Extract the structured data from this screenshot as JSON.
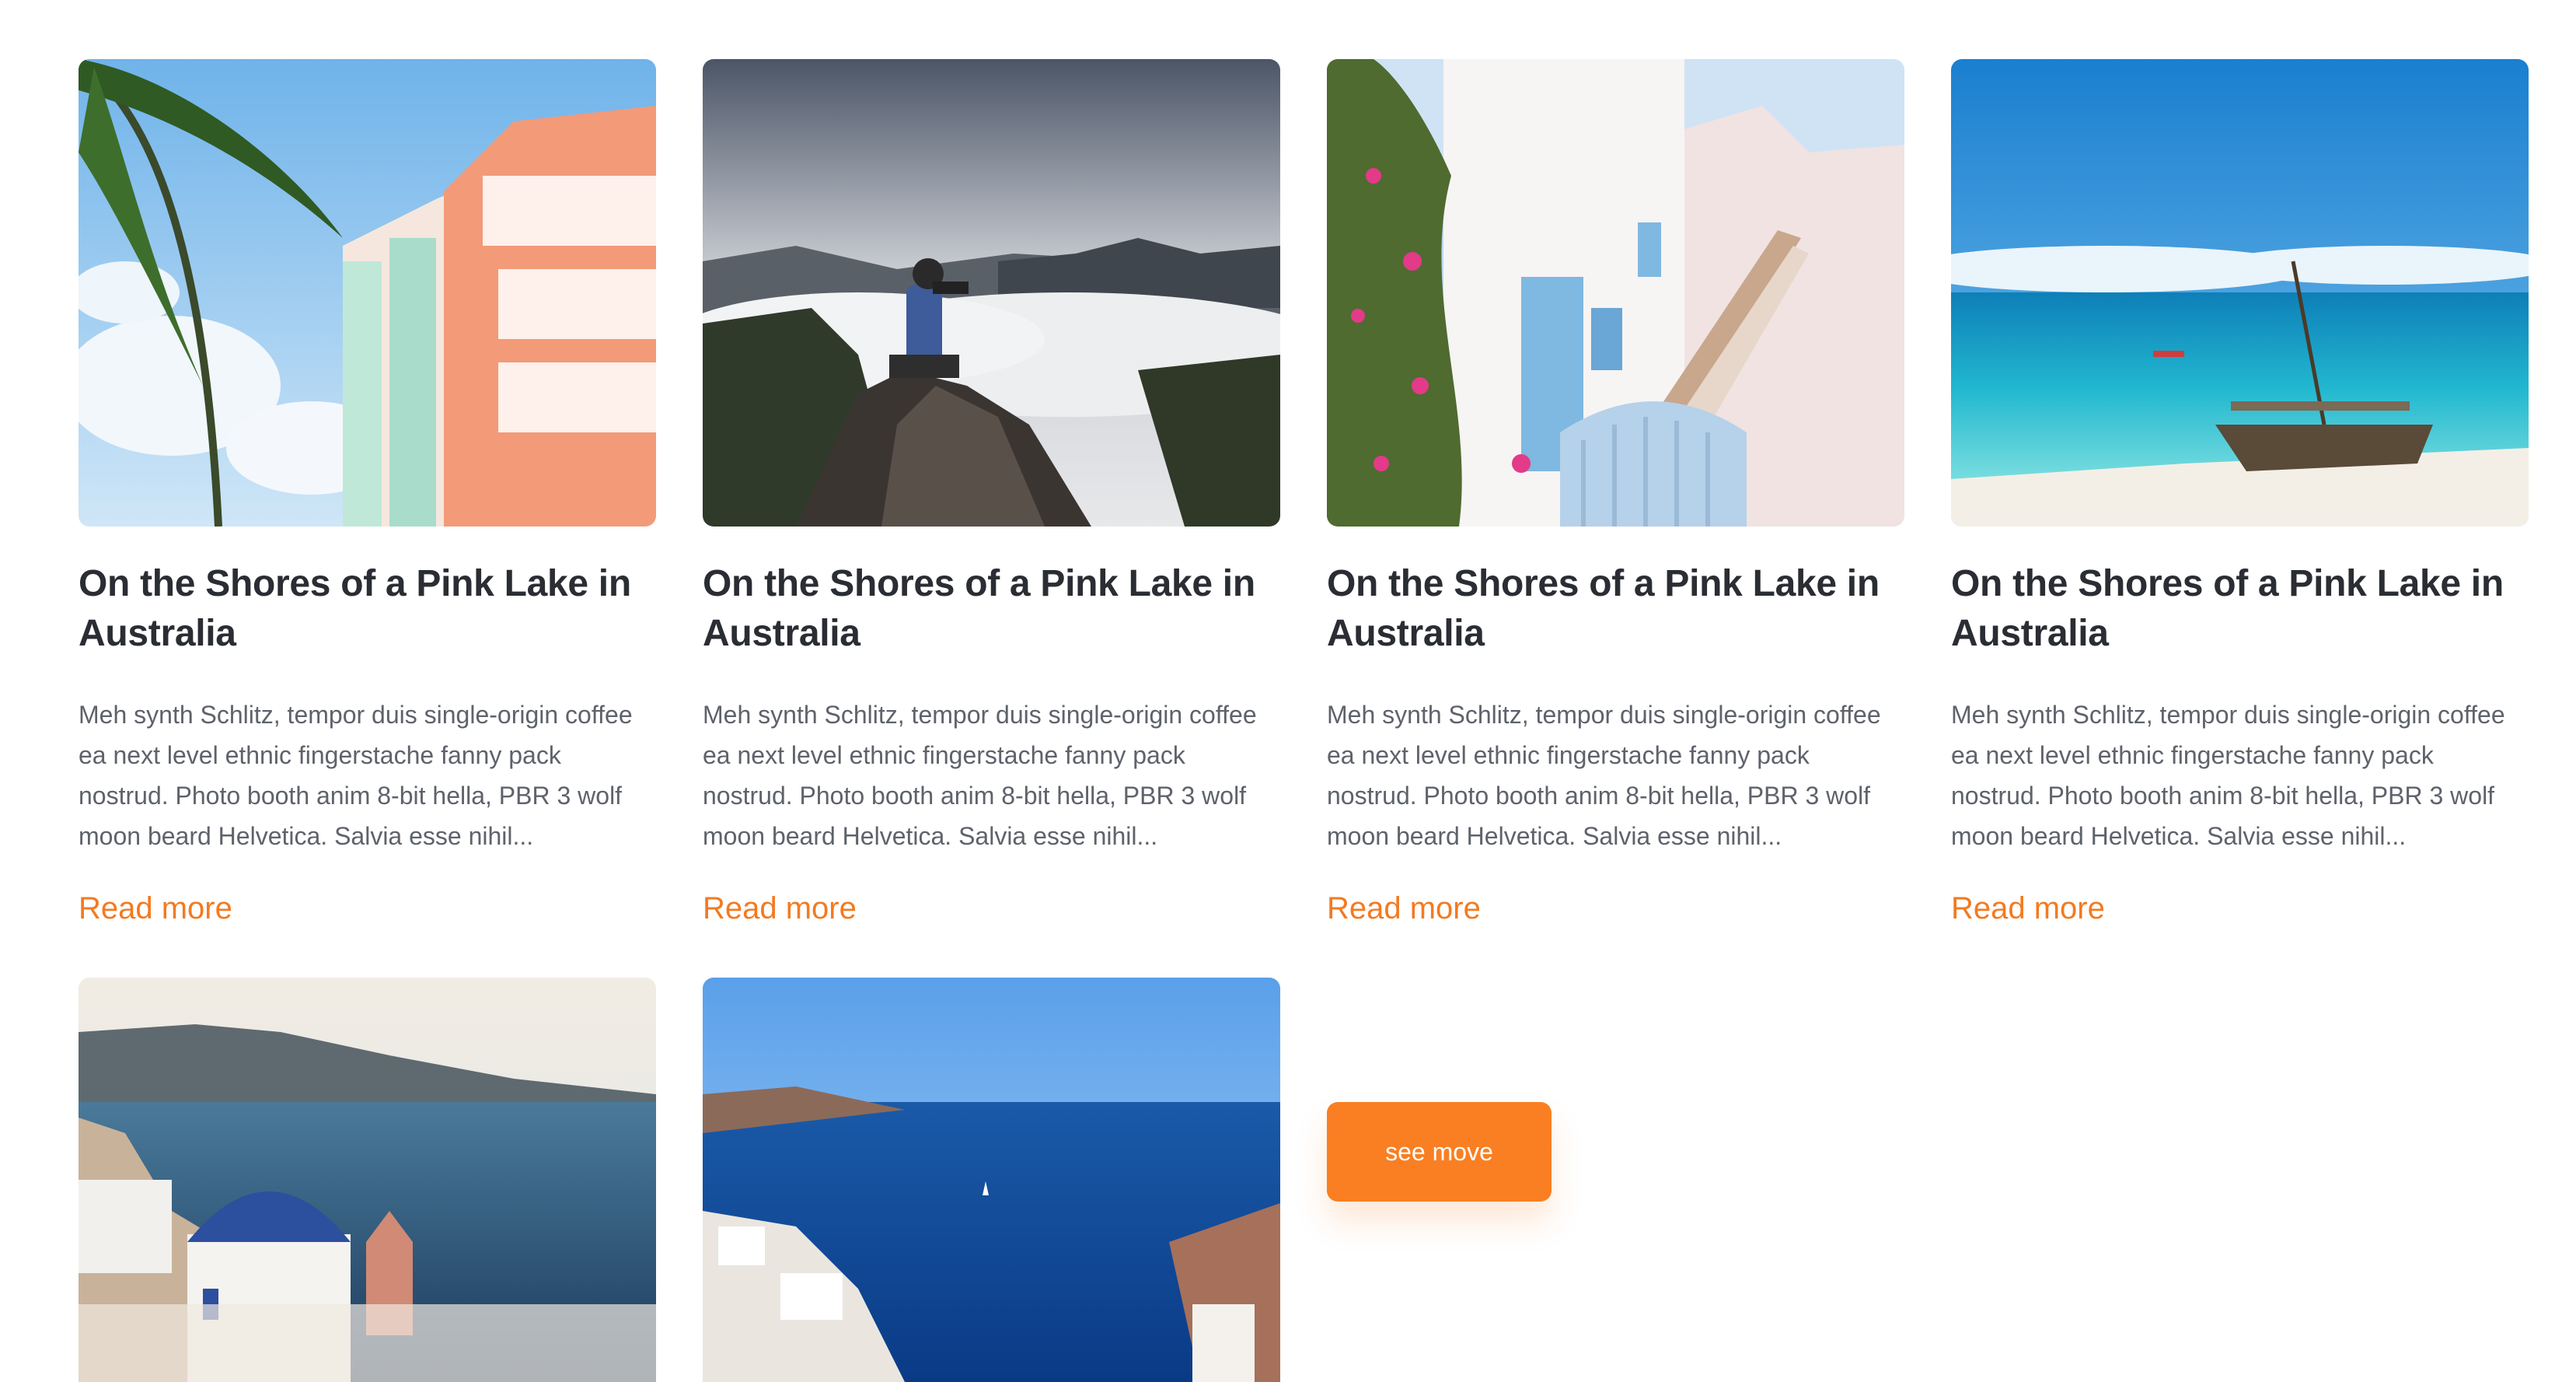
{
  "posts": [
    {
      "image": "pastel-art-deco-building-palm",
      "title": "On the Shores of a Pink Lake in Australia",
      "excerpt": "Meh synth Schlitz, tempor duis single-origin coffee ea next level ethnic fingerstache fanny pack nostrud. Photo booth anim 8-bit hella, PBR 3 wolf moon beard Helvetica. Salvia esse nihil...",
      "link_label": "Read more"
    },
    {
      "image": "photographer-on-cliff-above-clouds",
      "title": "On the Shores of a Pink Lake in Australia",
      "excerpt": "Meh synth Schlitz, tempor duis single-origin coffee ea next level ethnic fingerstache fanny pack nostrud. Photo booth anim 8-bit hella, PBR 3 wolf moon beard Helvetica. Salvia esse nihil...",
      "link_label": "Read more"
    },
    {
      "image": "white-greek-house-stairs-flowers",
      "title": "On the Shores of a Pink Lake in Australia",
      "excerpt": "Meh synth Schlitz, tempor duis single-origin coffee ea next level ethnic fingerstache fanny pack nostrud. Photo booth anim 8-bit hella, PBR 3 wolf moon beard Helvetica. Salvia esse nihil...",
      "link_label": "Read more"
    },
    {
      "image": "turquoise-beach-wooden-boat",
      "title": "On the Shores of a Pink Lake in Australia",
      "excerpt": "Meh synth Schlitz, tempor duis single-origin coffee ea next level ethnic fingerstache fanny pack nostrud. Photo booth anim 8-bit hella, PBR 3 wolf moon beard Helvetica. Salvia esse nihil...",
      "link_label": "Read more"
    }
  ],
  "row2_images": [
    "santorini-blue-dome-sea",
    "santorini-caldera-bay"
  ],
  "see_more_button": {
    "label": "see move"
  },
  "colors": {
    "accent": "#f97f22",
    "link": "#f47a20",
    "title": "#2a2d33",
    "body_text": "#5e626b"
  }
}
